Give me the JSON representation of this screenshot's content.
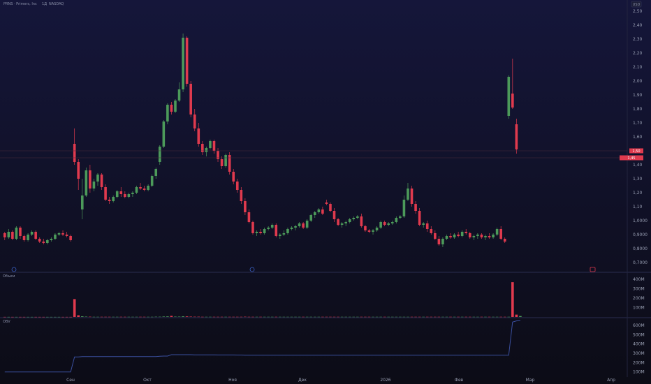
{
  "header": {
    "symbol": "PRNS · Primers, Inc",
    "interval": "1Д",
    "exchange": "NASDAQ",
    "currency": "USD"
  },
  "colors": {
    "background_top": "#141533",
    "background_bottom": "#0b0b14",
    "up": "#4c9a5a",
    "down": "#e03a4e",
    "line": "#3a4f9e",
    "axis_text": "#9aa0b4"
  },
  "price_axis": {
    "ticks": [
      "2,50",
      "2,40",
      "2,30",
      "2,20",
      "2,10",
      "2,00",
      "1,90",
      "1,80",
      "1,70",
      "1,60",
      "1,50",
      "1,40",
      "1,30",
      "1,20",
      "1,10",
      "1,0000",
      "0,9000",
      "0,8000",
      "0,7000"
    ]
  },
  "price_labels": {
    "current": "1,50",
    "last": "1,45"
  },
  "volume_pane": {
    "title": "Объем",
    "ticks": [
      "400M",
      "300M",
      "200M",
      "100M"
    ]
  },
  "indicator_pane": {
    "title": "OBV",
    "ticks": [
      "600M",
      "500M",
      "400M",
      "300M",
      "200M",
      "100M"
    ]
  },
  "time_axis": {
    "labels": [
      "Сен",
      "Окт",
      "Ноя",
      "Дек",
      "2026",
      "Фев",
      "Мар",
      "Апр"
    ]
  },
  "chart_data": [
    {
      "type": "candlestick",
      "ylim": [
        0.65,
        2.52
      ],
      "candles": [
        [
          0.91,
          0.92,
          0.86,
          0.88
        ],
        [
          0.88,
          0.94,
          0.87,
          0.92
        ],
        [
          0.92,
          0.93,
          0.86,
          0.87
        ],
        [
          0.87,
          0.96,
          0.86,
          0.95
        ],
        [
          0.95,
          0.96,
          0.87,
          0.89
        ],
        [
          0.89,
          0.9,
          0.85,
          0.86
        ],
        [
          0.86,
          0.91,
          0.85,
          0.9
        ],
        [
          0.9,
          0.93,
          0.89,
          0.92
        ],
        [
          0.92,
          0.93,
          0.86,
          0.87
        ],
        [
          0.87,
          0.88,
          0.84,
          0.85
        ],
        [
          0.85,
          0.87,
          0.83,
          0.84
        ],
        [
          0.84,
          0.87,
          0.83,
          0.86
        ],
        [
          0.86,
          0.88,
          0.85,
          0.87
        ],
        [
          0.87,
          0.91,
          0.86,
          0.9
        ],
        [
          0.9,
          0.92,
          0.89,
          0.91
        ],
        [
          0.91,
          0.93,
          0.89,
          0.9
        ],
        [
          0.9,
          0.92,
          0.88,
          0.89
        ],
        [
          0.89,
          0.9,
          0.85,
          0.86
        ],
        [
          1.55,
          1.66,
          1.4,
          1.42
        ],
        [
          1.42,
          1.44,
          1.22,
          1.3
        ],
        [
          1.08,
          1.3,
          1.01,
          1.18
        ],
        [
          1.18,
          1.38,
          1.17,
          1.36
        ],
        [
          1.36,
          1.4,
          1.2,
          1.23
        ],
        [
          1.23,
          1.3,
          1.21,
          1.28
        ],
        [
          1.28,
          1.34,
          1.25,
          1.33
        ],
        [
          1.33,
          1.34,
          1.22,
          1.24
        ],
        [
          1.24,
          1.26,
          1.14,
          1.15
        ],
        [
          1.15,
          1.17,
          1.12,
          1.14
        ],
        [
          1.14,
          1.18,
          1.13,
          1.17
        ],
        [
          1.17,
          1.22,
          1.16,
          1.21
        ],
        [
          1.21,
          1.24,
          1.17,
          1.19
        ],
        [
          1.19,
          1.21,
          1.16,
          1.17
        ],
        [
          1.17,
          1.2,
          1.16,
          1.19
        ],
        [
          1.19,
          1.21,
          1.17,
          1.2
        ],
        [
          1.2,
          1.25,
          1.19,
          1.24
        ],
        [
          1.24,
          1.27,
          1.22,
          1.23
        ],
        [
          1.23,
          1.25,
          1.21,
          1.22
        ],
        [
          1.22,
          1.26,
          1.21,
          1.25
        ],
        [
          1.25,
          1.33,
          1.24,
          1.32
        ],
        [
          1.32,
          1.38,
          1.3,
          1.37
        ],
        [
          1.42,
          1.54,
          1.4,
          1.53
        ],
        [
          1.53,
          1.72,
          1.52,
          1.71
        ],
        [
          1.71,
          1.84,
          1.69,
          1.83
        ],
        [
          1.83,
          1.85,
          1.76,
          1.78
        ],
        [
          1.78,
          1.87,
          1.77,
          1.86
        ],
        [
          1.86,
          1.99,
          1.85,
          1.94
        ],
        [
          1.94,
          2.34,
          1.92,
          2.31
        ],
        [
          2.31,
          2.32,
          1.96,
          1.98
        ],
        [
          1.98,
          2.0,
          1.74,
          1.76
        ],
        [
          1.76,
          1.8,
          1.64,
          1.66
        ],
        [
          1.66,
          1.7,
          1.53,
          1.55
        ],
        [
          1.55,
          1.57,
          1.47,
          1.49
        ],
        [
          1.49,
          1.53,
          1.46,
          1.52
        ],
        [
          1.52,
          1.58,
          1.51,
          1.57
        ],
        [
          1.57,
          1.58,
          1.48,
          1.5
        ],
        [
          1.5,
          1.52,
          1.42,
          1.44
        ],
        [
          1.44,
          1.46,
          1.37,
          1.39
        ],
        [
          1.39,
          1.48,
          1.38,
          1.47
        ],
        [
          1.47,
          1.49,
          1.33,
          1.35
        ],
        [
          1.35,
          1.37,
          1.26,
          1.28
        ],
        [
          1.28,
          1.3,
          1.2,
          1.22
        ],
        [
          1.22,
          1.24,
          1.12,
          1.14
        ],
        [
          1.14,
          1.16,
          1.04,
          1.06
        ],
        [
          1.06,
          1.08,
          0.98,
          0.99
        ],
        [
          0.99,
          1.0,
          0.9,
          0.91
        ],
        [
          0.91,
          0.93,
          0.89,
          0.92
        ],
        [
          0.92,
          0.94,
          0.9,
          0.91
        ],
        [
          0.91,
          0.95,
          0.9,
          0.94
        ],
        [
          0.94,
          0.96,
          0.93,
          0.95
        ],
        [
          0.95,
          0.98,
          0.94,
          0.97
        ],
        [
          0.97,
          0.98,
          0.88,
          0.89
        ],
        [
          0.89,
          0.91,
          0.87,
          0.9
        ],
        [
          0.9,
          0.93,
          0.89,
          0.91
        ],
        [
          0.91,
          0.95,
          0.9,
          0.94
        ],
        [
          0.94,
          0.96,
          0.93,
          0.95
        ],
        [
          0.95,
          0.97,
          0.93,
          0.96
        ],
        [
          0.96,
          0.99,
          0.95,
          0.98
        ],
        [
          0.98,
          0.99,
          0.94,
          0.95
        ],
        [
          0.95,
          1.01,
          0.94,
          1.0
        ],
        [
          1.0,
          1.05,
          0.99,
          1.04
        ],
        [
          1.04,
          1.07,
          1.02,
          1.06
        ],
        [
          1.06,
          1.09,
          1.05,
          1.08
        ],
        [
          1.08,
          1.1,
          1.04,
          1.05
        ],
        [
          1.13,
          1.15,
          1.11,
          1.12
        ],
        [
          1.12,
          1.13,
          1.06,
          1.07
        ],
        [
          1.07,
          1.09,
          0.99,
          1.01
        ],
        [
          1.01,
          1.02,
          0.96,
          0.97
        ],
        [
          0.97,
          0.99,
          0.95,
          0.98
        ],
        [
          0.98,
          1.0,
          0.96,
          0.99
        ],
        [
          0.99,
          1.02,
          0.98,
          1.01
        ],
        [
          1.01,
          1.03,
          1.0,
          1.02
        ],
        [
          1.02,
          1.04,
          1.01,
          1.03
        ],
        [
          1.03,
          1.05,
          0.95,
          0.96
        ],
        [
          0.96,
          0.97,
          0.92,
          0.93
        ],
        [
          0.93,
          0.94,
          0.91,
          0.92
        ],
        [
          0.92,
          0.94,
          0.9,
          0.93
        ],
        [
          0.93,
          0.96,
          0.92,
          0.95
        ],
        [
          0.95,
          1.0,
          0.94,
          0.99
        ],
        [
          0.99,
          1.0,
          0.96,
          0.97
        ],
        [
          0.97,
          0.99,
          0.96,
          0.98
        ],
        [
          0.98,
          1.0,
          0.97,
          0.99
        ],
        [
          0.99,
          1.03,
          0.98,
          1.02
        ],
        [
          1.02,
          1.04,
          1.01,
          1.03
        ],
        [
          1.03,
          1.18,
          1.02,
          1.15
        ],
        [
          1.15,
          1.27,
          1.14,
          1.23
        ],
        [
          1.23,
          1.25,
          1.1,
          1.12
        ],
        [
          1.12,
          1.14,
          1.05,
          1.07
        ],
        [
          1.07,
          1.09,
          0.96,
          0.97
        ],
        [
          0.97,
          0.99,
          0.95,
          0.98
        ],
        [
          0.98,
          1.0,
          0.92,
          0.94
        ],
        [
          0.94,
          0.96,
          0.9,
          0.91
        ],
        [
          0.91,
          0.93,
          0.86,
          0.87
        ],
        [
          0.87,
          0.89,
          0.82,
          0.83
        ],
        [
          0.83,
          0.88,
          0.81,
          0.87
        ],
        [
          0.87,
          0.9,
          0.86,
          0.89
        ],
        [
          0.89,
          0.91,
          0.87,
          0.88
        ],
        [
          0.88,
          0.91,
          0.87,
          0.9
        ],
        [
          0.9,
          0.92,
          0.88,
          0.89
        ],
        [
          0.89,
          0.93,
          0.88,
          0.92
        ],
        [
          0.92,
          0.94,
          0.9,
          0.91
        ],
        [
          0.91,
          0.92,
          0.87,
          0.88
        ],
        [
          0.88,
          0.9,
          0.86,
          0.89
        ],
        [
          0.89,
          0.91,
          0.87,
          0.9
        ],
        [
          0.9,
          0.91,
          0.87,
          0.88
        ],
        [
          0.88,
          0.9,
          0.86,
          0.89
        ],
        [
          0.89,
          0.91,
          0.87,
          0.88
        ],
        [
          0.88,
          0.91,
          0.87,
          0.9
        ],
        [
          0.9,
          0.95,
          0.89,
          0.94
        ],
        [
          0.94,
          0.96,
          0.86,
          0.87
        ],
        [
          0.87,
          0.88,
          0.84,
          0.85
        ],
        [
          1.75,
          2.04,
          1.73,
          2.03
        ],
        [
          1.91,
          2.16,
          1.8,
          1.81
        ],
        [
          1.69,
          1.73,
          1.48,
          1.51
        ]
      ]
    },
    {
      "type": "bar",
      "name": "Объем",
      "ylim": [
        0,
        460
      ],
      "values": [
        1,
        1,
        1,
        1,
        1,
        1,
        1,
        1,
        1,
        1,
        1,
        1,
        1,
        1,
        1,
        1,
        1,
        1,
        190,
        18,
        7,
        4,
        3,
        2,
        2,
        2,
        2,
        2,
        2,
        2,
        2,
        2,
        2,
        2,
        2,
        2,
        2,
        2,
        2,
        3,
        3,
        5,
        6,
        12,
        4,
        4,
        7,
        6,
        4,
        3,
        3,
        2,
        2,
        2,
        2,
        2,
        2,
        2,
        2,
        2,
        2,
        2,
        3,
        2,
        2,
        2,
        2,
        2,
        2,
        2,
        2,
        2,
        2,
        2,
        2,
        2,
        2,
        2,
        2,
        2,
        2,
        2,
        2,
        2,
        2,
        2,
        2,
        2,
        2,
        2,
        2,
        2,
        2,
        2,
        2,
        2,
        2,
        2,
        2,
        2,
        2,
        2,
        2,
        2,
        2,
        2,
        2,
        2,
        2,
        2,
        2,
        2,
        2,
        2,
        2,
        2,
        2,
        2,
        2,
        2,
        2,
        2,
        2,
        2,
        2,
        2,
        2,
        2,
        2,
        2,
        2,
        370,
        25,
        10
      ]
    },
    {
      "type": "line",
      "name": "OBV",
      "ylim": [
        60,
        660
      ],
      "values": [
        100,
        100,
        100,
        100,
        100,
        100,
        100,
        100,
        100,
        100,
        100,
        100,
        100,
        100,
        100,
        100,
        100,
        100,
        260,
        260,
        265,
        265,
        265,
        265,
        265,
        265,
        265,
        265,
        265,
        265,
        265,
        265,
        265,
        265,
        265,
        265,
        265,
        265,
        265,
        265,
        268,
        270,
        270,
        285,
        285,
        285,
        285,
        285,
        285,
        283,
        283,
        283,
        283,
        283,
        283,
        282,
        282,
        282,
        282,
        282,
        281,
        281,
        280,
        280,
        280,
        280,
        280,
        280,
        280,
        280,
        280,
        280,
        280,
        280,
        280,
        280,
        280,
        280,
        280,
        280,
        280,
        280,
        280,
        280,
        280,
        280,
        280,
        280,
        280,
        280,
        280,
        280,
        280,
        280,
        280,
        280,
        280,
        280,
        280,
        280,
        280,
        280,
        280,
        280,
        280,
        280,
        280,
        280,
        280,
        280,
        280,
        280,
        280,
        280,
        280,
        280,
        280,
        280,
        280,
        280,
        280,
        280,
        280,
        280,
        280,
        280,
        280,
        280,
        280,
        280,
        280,
        635,
        648,
        650
      ]
    }
  ]
}
